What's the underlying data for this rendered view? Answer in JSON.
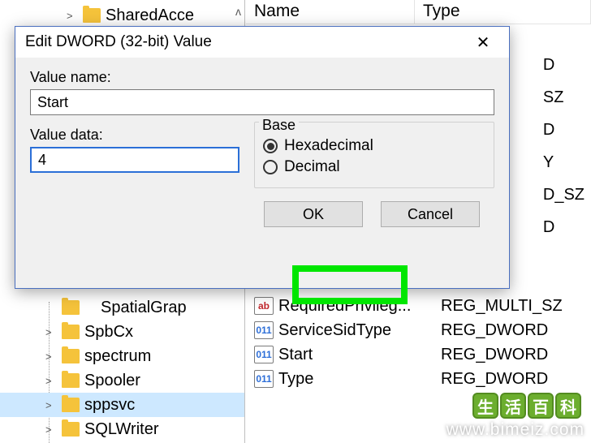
{
  "bg": {
    "header": {
      "name": "Name",
      "type": "Type"
    },
    "tree_top": {
      "label": "SharedAcce",
      "chev": ">"
    },
    "tree_items": [
      {
        "label": "SpatialGrap",
        "chev": ""
      },
      {
        "label": "SpbCx",
        "chev": ">"
      },
      {
        "label": "spectrum",
        "chev": ">"
      },
      {
        "label": "Spooler",
        "chev": ">"
      },
      {
        "label": "sppsvc",
        "chev": ">",
        "sel": true
      },
      {
        "label": "SQLWriter",
        "chev": ">"
      }
    ],
    "list_partial": [
      {
        "name_suffix": "D",
        "type_suffix": ""
      },
      {
        "name_suffix": "SZ",
        "type_suffix": ""
      },
      {
        "name_suffix": "",
        "type_suffix": ""
      },
      {
        "name_suffix": "D",
        "type_suffix": ""
      },
      {
        "name_suffix": "Y",
        "type_suffix": ""
      },
      {
        "name_suffix": "D_SZ",
        "type_suffix": ""
      },
      {
        "name_suffix": "D",
        "type_suffix": ""
      }
    ],
    "list_rows": [
      {
        "icon": "ab",
        "name": "RequiredPrivileg...",
        "type": "REG_MULTI_SZ"
      },
      {
        "icon": "bin",
        "name": "ServiceSidType",
        "type": "REG_DWORD"
      },
      {
        "icon": "bin",
        "name": "Start",
        "type": "REG_DWORD"
      },
      {
        "icon": "bin",
        "name": "Type",
        "type": "REG_DWORD"
      }
    ]
  },
  "dialog": {
    "title": "Edit DWORD (32-bit) Value",
    "close": "✕",
    "value_name_label": "Value name:",
    "value_name": "Start",
    "value_data_label": "Value data:",
    "value_data": "4",
    "base_label": "Base",
    "hex_label": "Hexadecimal",
    "dec_label": "Decimal",
    "ok": "OK",
    "cancel": "Cancel"
  },
  "watermark": {
    "badge": [
      "生",
      "活",
      "百",
      "科"
    ],
    "url": "www.bimeiz.com"
  }
}
